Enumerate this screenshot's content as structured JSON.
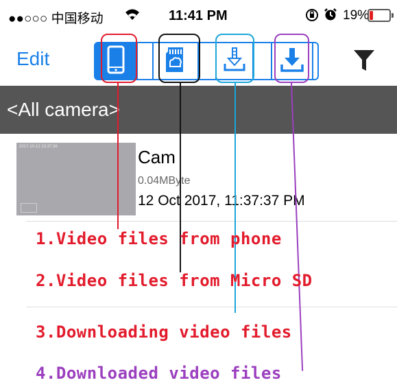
{
  "status_bar": {
    "carrier": "●●○○○ 中国移动",
    "time": "11:41 PM",
    "battery_percent": "19%",
    "battery_level": 0.19,
    "icons": [
      "wifi-icon",
      "orientation-lock-icon",
      "alarm-icon",
      "battery-icon"
    ]
  },
  "nav": {
    "edit_label": "Edit",
    "segments": [
      {
        "icon": "phone-icon",
        "selected": true
      },
      {
        "icon": "micro-sd-icon",
        "selected": false
      },
      {
        "icon": "downloading-icon",
        "selected": false
      },
      {
        "icon": "downloaded-icon",
        "selected": false
      }
    ],
    "filter_icon": "filter-icon",
    "accent_color": "#1a80e8"
  },
  "camera_header": {
    "title": "<All camera>"
  },
  "files": [
    {
      "thumb_timestamp": "2017-10-12 23:37:36",
      "name": "Cam",
      "size": "0.04MByte",
      "date": "12 Oct 2017, 11:37:37 PM"
    }
  ],
  "annotations": [
    {
      "text": "1.Video files from phone",
      "color": "#e21b2c"
    },
    {
      "text": "2.Video files from Micro SD",
      "color": "#e21b2c"
    },
    {
      "text": "3.Downloading video files",
      "color": "#e21b2c"
    },
    {
      "text": "4.Downloaded video files",
      "color": "#9b3fbf"
    }
  ]
}
